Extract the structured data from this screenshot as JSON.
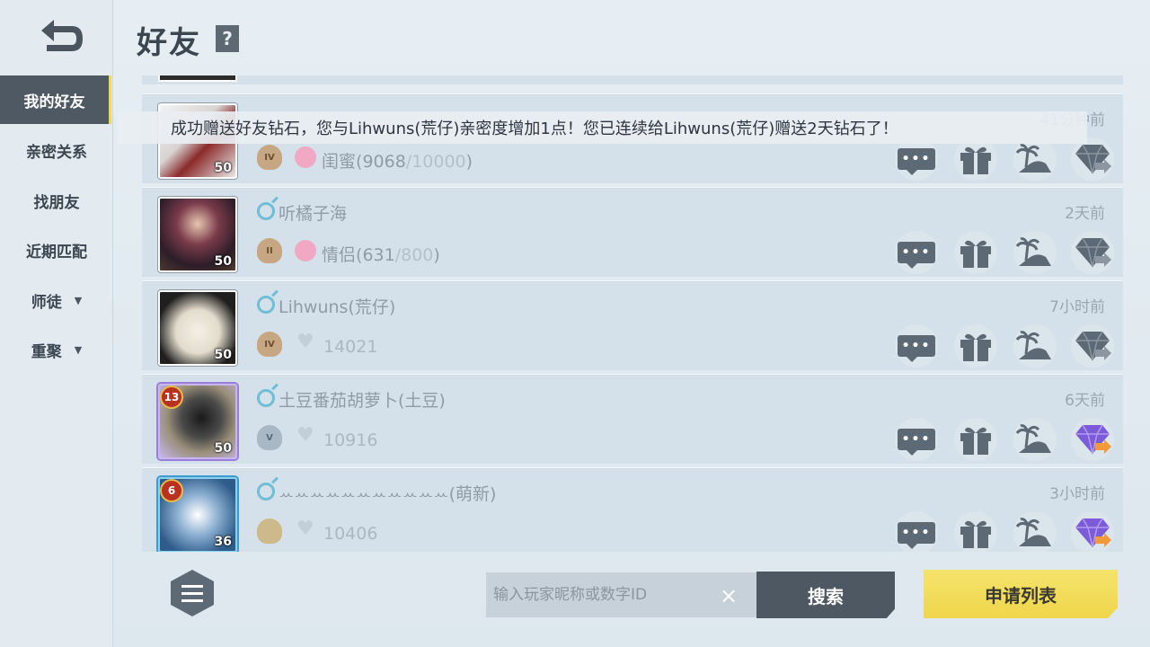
{
  "header": {
    "title": "好友",
    "help_label": "?"
  },
  "sidebar": {
    "items": [
      {
        "label": "我的好友",
        "active": true
      },
      {
        "label": "亲密关系"
      },
      {
        "label": "找朋友"
      },
      {
        "label": "近期匹配"
      },
      {
        "label": "师徒",
        "caret": "▼"
      },
      {
        "label": "重聚",
        "caret": "▼"
      }
    ]
  },
  "toast": {
    "message": "成功赠送好友钻石，您与Lihwuns(荒仔)亲密度增加1点！您已连续给Lihwuns(荒仔)赠送2天钻石了！"
  },
  "friends": [
    {
      "name": "",
      "level": "50",
      "rank": "IV",
      "relation": "闺蜜",
      "intimacy": "9068",
      "intimacy_max": "/10000",
      "time": "41分钟前"
    },
    {
      "name": "听橘子海",
      "level": "50",
      "rank": "II",
      "relation": "情侣",
      "intimacy": "631",
      "intimacy_max": "/800",
      "time": "2天前"
    },
    {
      "name": "Lihwuns(荒仔)",
      "level": "50",
      "rank": "IV",
      "score": "14021",
      "time": "7小时前"
    },
    {
      "name": "土豆番茄胡萝卜(土豆)",
      "level": "50",
      "badge": "13",
      "rank": "V",
      "score": "10916",
      "time": "6天前"
    },
    {
      "name": "ꕀꕀꕀꕀꕀꕀꕀꕀꕀꕀꕀ(萌新)",
      "level": "36",
      "badge": "6",
      "rank": "",
      "score": "10406",
      "time": "3小时前"
    }
  ],
  "search": {
    "placeholder": "输入玩家昵称或数字ID",
    "clear_label": "×",
    "button_label": "搜索"
  },
  "apply_list_label": "申请列表",
  "colors": {
    "accent_yellow": "#efd64a",
    "active_nav": "#4f5963",
    "gender_male": "#71bcd6"
  }
}
